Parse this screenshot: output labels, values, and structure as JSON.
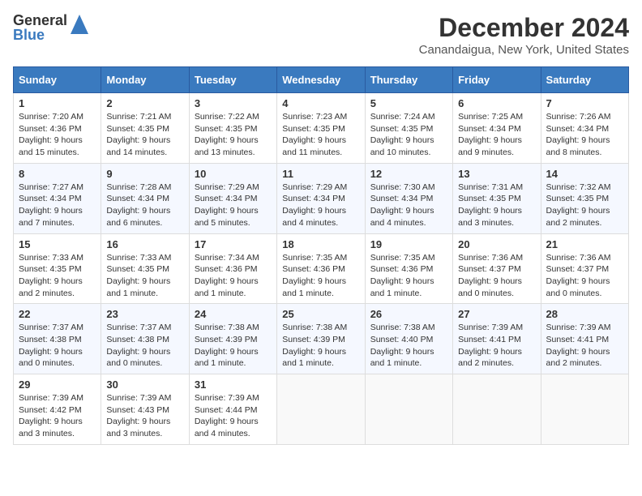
{
  "header": {
    "logo_general": "General",
    "logo_blue": "Blue",
    "title": "December 2024",
    "subtitle": "Canandaigua, New York, United States"
  },
  "days_of_week": [
    "Sunday",
    "Monday",
    "Tuesday",
    "Wednesday",
    "Thursday",
    "Friday",
    "Saturday"
  ],
  "weeks": [
    [
      {
        "day": "1",
        "sunrise": "7:20 AM",
        "sunset": "4:36 PM",
        "daylight": "9 hours and 15 minutes."
      },
      {
        "day": "2",
        "sunrise": "7:21 AM",
        "sunset": "4:35 PM",
        "daylight": "9 hours and 14 minutes."
      },
      {
        "day": "3",
        "sunrise": "7:22 AM",
        "sunset": "4:35 PM",
        "daylight": "9 hours and 13 minutes."
      },
      {
        "day": "4",
        "sunrise": "7:23 AM",
        "sunset": "4:35 PM",
        "daylight": "9 hours and 11 minutes."
      },
      {
        "day": "5",
        "sunrise": "7:24 AM",
        "sunset": "4:35 PM",
        "daylight": "9 hours and 10 minutes."
      },
      {
        "day": "6",
        "sunrise": "7:25 AM",
        "sunset": "4:34 PM",
        "daylight": "9 hours and 9 minutes."
      },
      {
        "day": "7",
        "sunrise": "7:26 AM",
        "sunset": "4:34 PM",
        "daylight": "9 hours and 8 minutes."
      }
    ],
    [
      {
        "day": "8",
        "sunrise": "7:27 AM",
        "sunset": "4:34 PM",
        "daylight": "9 hours and 7 minutes."
      },
      {
        "day": "9",
        "sunrise": "7:28 AM",
        "sunset": "4:34 PM",
        "daylight": "9 hours and 6 minutes."
      },
      {
        "day": "10",
        "sunrise": "7:29 AM",
        "sunset": "4:34 PM",
        "daylight": "9 hours and 5 minutes."
      },
      {
        "day": "11",
        "sunrise": "7:29 AM",
        "sunset": "4:34 PM",
        "daylight": "9 hours and 4 minutes."
      },
      {
        "day": "12",
        "sunrise": "7:30 AM",
        "sunset": "4:34 PM",
        "daylight": "9 hours and 4 minutes."
      },
      {
        "day": "13",
        "sunrise": "7:31 AM",
        "sunset": "4:35 PM",
        "daylight": "9 hours and 3 minutes."
      },
      {
        "day": "14",
        "sunrise": "7:32 AM",
        "sunset": "4:35 PM",
        "daylight": "9 hours and 2 minutes."
      }
    ],
    [
      {
        "day": "15",
        "sunrise": "7:33 AM",
        "sunset": "4:35 PM",
        "daylight": "9 hours and 2 minutes."
      },
      {
        "day": "16",
        "sunrise": "7:33 AM",
        "sunset": "4:35 PM",
        "daylight": "9 hours and 1 minute."
      },
      {
        "day": "17",
        "sunrise": "7:34 AM",
        "sunset": "4:36 PM",
        "daylight": "9 hours and 1 minute."
      },
      {
        "day": "18",
        "sunrise": "7:35 AM",
        "sunset": "4:36 PM",
        "daylight": "9 hours and 1 minute."
      },
      {
        "day": "19",
        "sunrise": "7:35 AM",
        "sunset": "4:36 PM",
        "daylight": "9 hours and 1 minute."
      },
      {
        "day": "20",
        "sunrise": "7:36 AM",
        "sunset": "4:37 PM",
        "daylight": "9 hours and 0 minutes."
      },
      {
        "day": "21",
        "sunrise": "7:36 AM",
        "sunset": "4:37 PM",
        "daylight": "9 hours and 0 minutes."
      }
    ],
    [
      {
        "day": "22",
        "sunrise": "7:37 AM",
        "sunset": "4:38 PM",
        "daylight": "9 hours and 0 minutes."
      },
      {
        "day": "23",
        "sunrise": "7:37 AM",
        "sunset": "4:38 PM",
        "daylight": "9 hours and 0 minutes."
      },
      {
        "day": "24",
        "sunrise": "7:38 AM",
        "sunset": "4:39 PM",
        "daylight": "9 hours and 1 minute."
      },
      {
        "day": "25",
        "sunrise": "7:38 AM",
        "sunset": "4:39 PM",
        "daylight": "9 hours and 1 minute."
      },
      {
        "day": "26",
        "sunrise": "7:38 AM",
        "sunset": "4:40 PM",
        "daylight": "9 hours and 1 minute."
      },
      {
        "day": "27",
        "sunrise": "7:39 AM",
        "sunset": "4:41 PM",
        "daylight": "9 hours and 2 minutes."
      },
      {
        "day": "28",
        "sunrise": "7:39 AM",
        "sunset": "4:41 PM",
        "daylight": "9 hours and 2 minutes."
      }
    ],
    [
      {
        "day": "29",
        "sunrise": "7:39 AM",
        "sunset": "4:42 PM",
        "daylight": "9 hours and 3 minutes."
      },
      {
        "day": "30",
        "sunrise": "7:39 AM",
        "sunset": "4:43 PM",
        "daylight": "9 hours and 3 minutes."
      },
      {
        "day": "31",
        "sunrise": "7:39 AM",
        "sunset": "4:44 PM",
        "daylight": "9 hours and 4 minutes."
      },
      null,
      null,
      null,
      null
    ]
  ],
  "labels": {
    "sunrise": "Sunrise:",
    "sunset": "Sunset:",
    "daylight": "Daylight:"
  }
}
